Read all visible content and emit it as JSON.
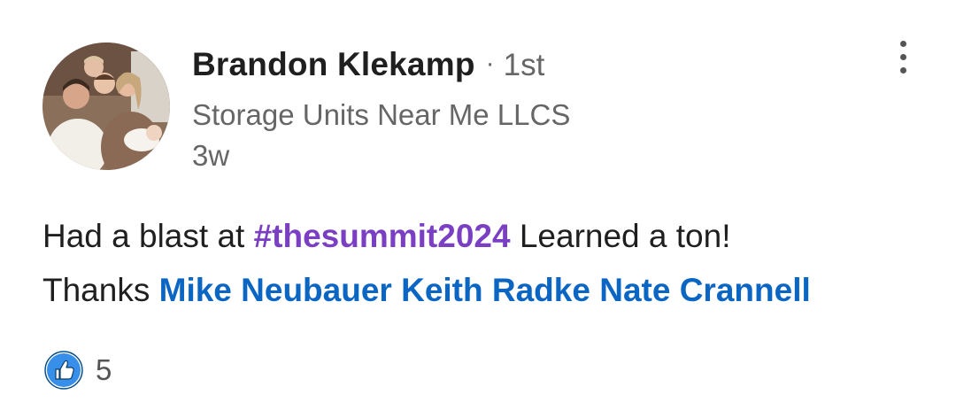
{
  "post": {
    "author": {
      "name": "Brandon Klekamp",
      "separator": "·",
      "connection_degree": "1st",
      "headline": "Storage Units Near Me LLCS",
      "time_ago": "3w"
    },
    "body": {
      "line1_before": "Had a blast at ",
      "hashtag": "#thesummit2024",
      "line1_after": " Learned a ton!",
      "line2_prefix": "Thanks ",
      "mentions": [
        "Mike Neubauer",
        "Keith Radke",
        "Nate Crannell"
      ]
    },
    "reactions": {
      "icon": "like-icon",
      "count": "5"
    },
    "menu_icon": "more-vertical-icon"
  },
  "colors": {
    "hashtag": "#7b3fc4",
    "mention": "#0a66c2",
    "like_badge": "#378fe9",
    "secondary_text": "#666666"
  }
}
